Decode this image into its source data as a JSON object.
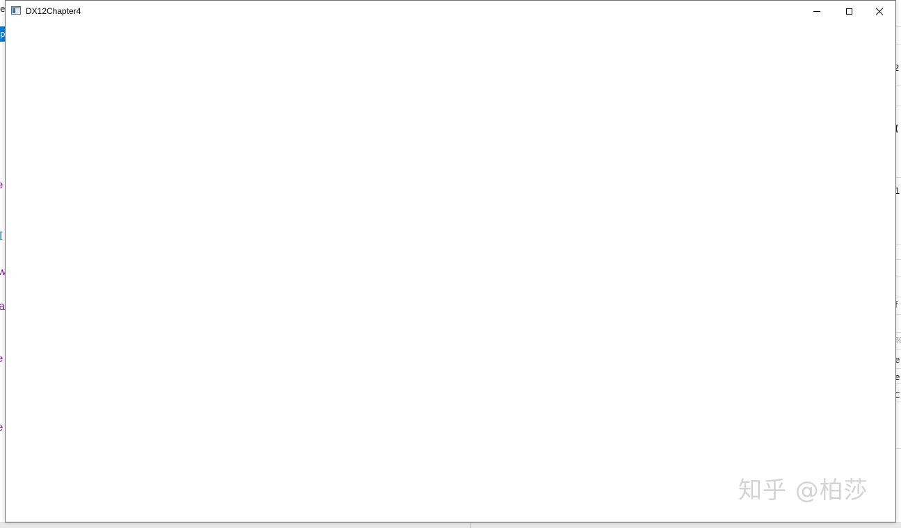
{
  "window": {
    "title": "DX12Chapter4",
    "icon": "app-window-icon",
    "controls": {
      "minimize": "minimize-icon",
      "maximize": "maximize-icon",
      "close": "close-icon"
    }
  },
  "background": {
    "left_fragments": [
      "e",
      "p",
      "e",
      "I",
      "w",
      "a",
      "e",
      "e"
    ],
    "right_fragments": [
      "2",
      "(",
      "1",
      "f",
      "%",
      "e",
      "e",
      "C"
    ]
  },
  "watermark": {
    "text": "知乎 @柏莎"
  },
  "colors": {
    "accent": "#0a7bd6",
    "code_keyword": "#8a1a9b",
    "code_type": "#2b91af"
  }
}
